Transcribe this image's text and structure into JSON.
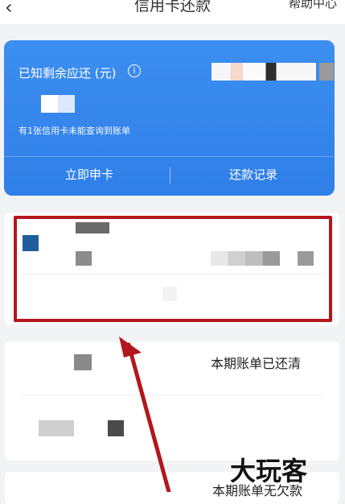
{
  "header": {
    "back_icon": "chevron-left-icon",
    "title": "信用卡还款",
    "help_label": "帮助中心"
  },
  "summary": {
    "label": "已知剩余应还 (元)",
    "info_icon": "info-icon",
    "note": "有1张信用卡未能查询到账单",
    "apply_button": "立即申卡",
    "history_button": "还款记录"
  },
  "cards": {
    "status_paid": "本期账单已还清",
    "status_no_debt": "本期账单无欠款"
  },
  "watermark": "大玩客",
  "colors": {
    "accent_blue": "#2f7fe8",
    "highlight_red": "#b3161d"
  }
}
